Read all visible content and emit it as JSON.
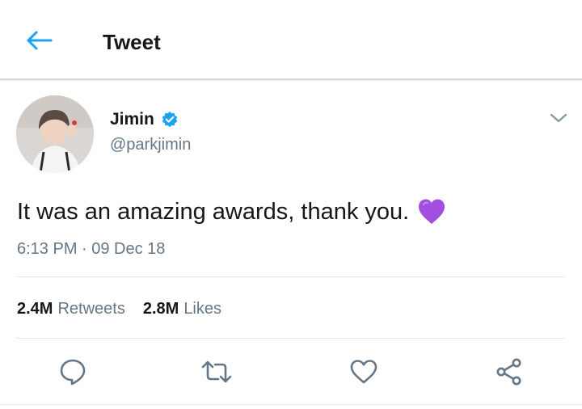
{
  "header": {
    "title": "Tweet",
    "back_icon": "arrow-left-icon"
  },
  "tweet": {
    "author": {
      "display_name": "Jimin",
      "handle": "@parkjimin",
      "verified": true
    },
    "text": "It was an amazing awards, thank you.",
    "emoji": "purple-heart",
    "timestamp": "6:13 PM · 09 Dec 18",
    "stats": {
      "retweets_count": "2.4M",
      "retweets_label": "Retweets",
      "likes_count": "2.8M",
      "likes_label": "Likes"
    }
  },
  "actions": [
    "reply-icon",
    "retweet-icon",
    "like-icon",
    "share-icon"
  ],
  "colors": {
    "accent": "#1da1f2",
    "text_primary": "#14171a",
    "text_secondary": "#657786",
    "divider": "#e1e8ed",
    "emoji_heart": "#a24ee0"
  }
}
